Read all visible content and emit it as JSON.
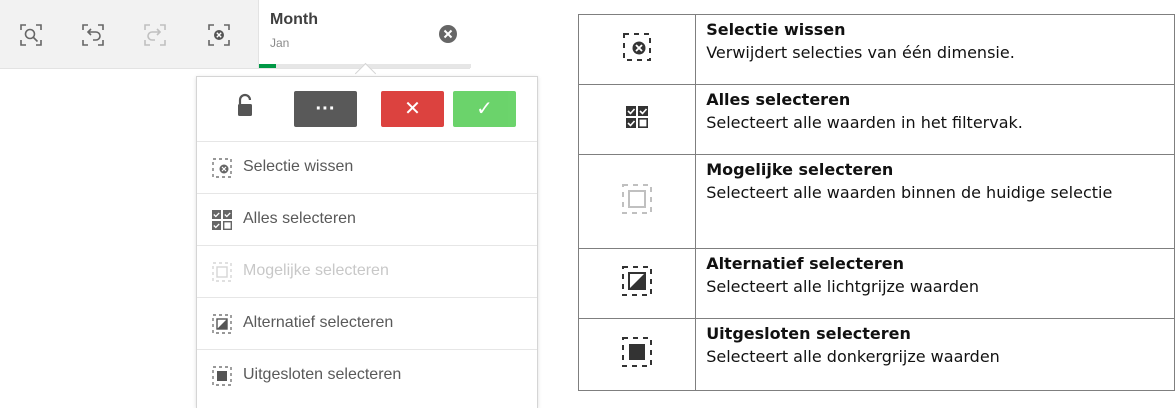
{
  "toolbar": {
    "icons": [
      "smart-search-icon",
      "step-back-icon",
      "step-forward-icon",
      "clear-all-selections-icon"
    ],
    "month_filter": {
      "title": "Month",
      "value": "Jan",
      "progress_fraction": 0.08,
      "progress_color": "#009845"
    }
  },
  "selection_popup": {
    "actions": {
      "lock_icon": "unlock-icon",
      "more_label": "···",
      "cancel_label": "✕",
      "confirm_label": "✓",
      "colors": {
        "more": "#595959",
        "cancel": "#dc423f",
        "confirm": "#52cc52"
      }
    },
    "menu_items": [
      {
        "label": "Selectie wissen",
        "icon": "clear-selection-icon",
        "enabled": true
      },
      {
        "label": "Alles selecteren",
        "icon": "select-all-icon",
        "enabled": true
      },
      {
        "label": "Mogelijke selecteren",
        "icon": "select-possible-icon",
        "enabled": false
      },
      {
        "label": "Alternatief selecteren",
        "icon": "select-alternative-icon",
        "enabled": true
      },
      {
        "label": "Uitgesloten selecteren",
        "icon": "select-excluded-icon",
        "enabled": true
      }
    ]
  },
  "reference_table": {
    "rows": [
      {
        "icon": "clear-selection-icon",
        "title": "Selectie wissen",
        "description": "Verwijdert selecties van één dimensie."
      },
      {
        "icon": "select-all-icon",
        "title": "Alles selecteren",
        "description": "Selecteert alle waarden in het filtervak."
      },
      {
        "icon": "select-possible-icon",
        "title": "Mogelijke selecteren",
        "description": "Selecteert alle waarden binnen de huidige selectie"
      },
      {
        "icon": "select-alternative-icon",
        "title": "Alternatief selecteren",
        "description": "Selecteert alle lichtgrijze waarden"
      },
      {
        "icon": "select-excluded-icon",
        "title": "Uitgesloten selecteren",
        "description": "Selecteert alle donkergrijze waarden"
      }
    ]
  }
}
